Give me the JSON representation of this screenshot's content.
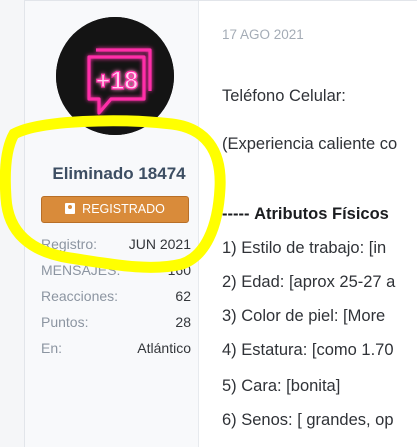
{
  "user": {
    "name": "Eliminado 18474",
    "badge_label": "REGISTRADO",
    "avatar_text": "+18",
    "stats": [
      {
        "key": "Registro:",
        "value": "JUN 2021"
      },
      {
        "key": "MENSAJES:",
        "value": "160"
      },
      {
        "key": "Reacciones:",
        "value": "62"
      },
      {
        "key": "Puntos:",
        "value": "28"
      },
      {
        "key": "En:",
        "value": "Atlántico"
      }
    ]
  },
  "post": {
    "date": "17 AGO 2021",
    "phone_label": "Teléfono Celular:",
    "experience": "(Experiencia caliente co",
    "attributes_heading": "Atributos Físicos",
    "attributes_prefix": "-----",
    "items": [
      "1) Estilo de trabajo: [in",
      "2) Edad: [aprox 25-27 a",
      "3) Color de piel: [More",
      "4) Estatura: [como 1.70",
      "5) Cara: [bonita]",
      "6) Senos: [ grandes, op"
    ]
  },
  "colors": {
    "accent_badge": "#d98b3a",
    "highlight": "#ffff00",
    "neon": "#ff2fa8"
  }
}
